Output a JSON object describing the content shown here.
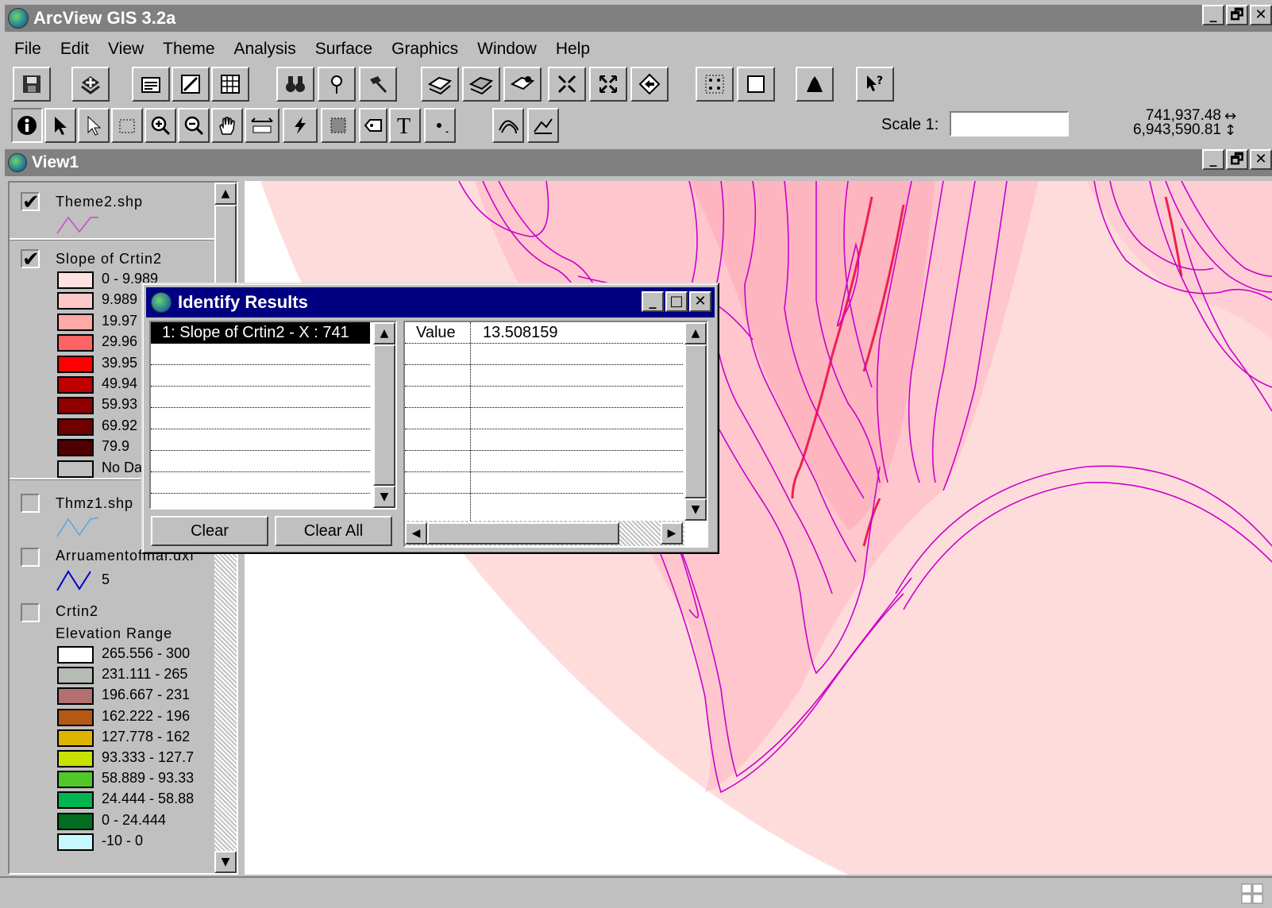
{
  "app": {
    "title": "ArcView GIS 3.2a",
    "menu": [
      "File",
      "Edit",
      "View",
      "Theme",
      "Analysis",
      "Surface",
      "Graphics",
      "Window",
      "Help"
    ]
  },
  "toolbar2": {
    "scale_label": "Scale 1:",
    "scale_value": "",
    "coord_x": "741,937.48",
    "coord_y": "6,943,590.81"
  },
  "view": {
    "title": "View1"
  },
  "toc": {
    "themes": [
      {
        "name": "Theme2.shp",
        "checked": true
      },
      {
        "name": "Slope of Crtin2",
        "checked": true
      },
      {
        "name": "Thmz1.shp",
        "checked": false
      },
      {
        "name": "Arruamentofinal.dxf",
        "checked": false
      },
      {
        "name": "Crtin2",
        "checked": false
      }
    ],
    "check_mark": "✔",
    "slope_classes": [
      {
        "label": "0 - 9.989",
        "color": "#ffe0e0"
      },
      {
        "label": "9.989",
        "color": "#ffc8c8"
      },
      {
        "label": "19.97",
        "color": "#ffa8a8"
      },
      {
        "label": "29.96",
        "color": "#ff6464"
      },
      {
        "label": "39.95",
        "color": "#ff0000"
      },
      {
        "label": "49.94",
        "color": "#c00000"
      },
      {
        "label": "59.93",
        "color": "#900000"
      },
      {
        "label": "69.92",
        "color": "#700000"
      },
      {
        "label": "79.9",
        "color": "#500000"
      },
      {
        "label": "No Data",
        "color": "#c0c0c0"
      }
    ],
    "arruamento_line_label": "5",
    "elevation_title": "Elevation Range",
    "elevation_classes": [
      {
        "label": "265.556 - 300",
        "color": "#ffffff"
      },
      {
        "label": "231.111 - 265",
        "color": "#b4bcb4"
      },
      {
        "label": "196.667 - 231",
        "color": "#b47070"
      },
      {
        "label": "162.222 - 196",
        "color": "#b45814"
      },
      {
        "label": "127.778 - 162",
        "color": "#dcb400"
      },
      {
        "label": "93.333 - 127.7",
        "color": "#c8e000"
      },
      {
        "label": "58.889 - 93.33",
        "color": "#50c828"
      },
      {
        "label": "24.444 - 58.88",
        "color": "#00b450"
      },
      {
        "label": "0 - 24.444",
        "color": "#006e1e"
      },
      {
        "label": "-10 - 0",
        "color": "#c8f8ff"
      }
    ]
  },
  "identify": {
    "title": "Identify Results",
    "results": [
      "1:  Slope of Crtin2 - X : 741"
    ],
    "attr_name": "Value",
    "attr_value": "13.508159",
    "clear_label": "Clear",
    "clear_all_label": "Clear All"
  },
  "colors": {
    "title_active": "#000080",
    "title_inactive": "#808080",
    "contour": "#cc00cc",
    "slope_fill": "#ffdcdc"
  }
}
